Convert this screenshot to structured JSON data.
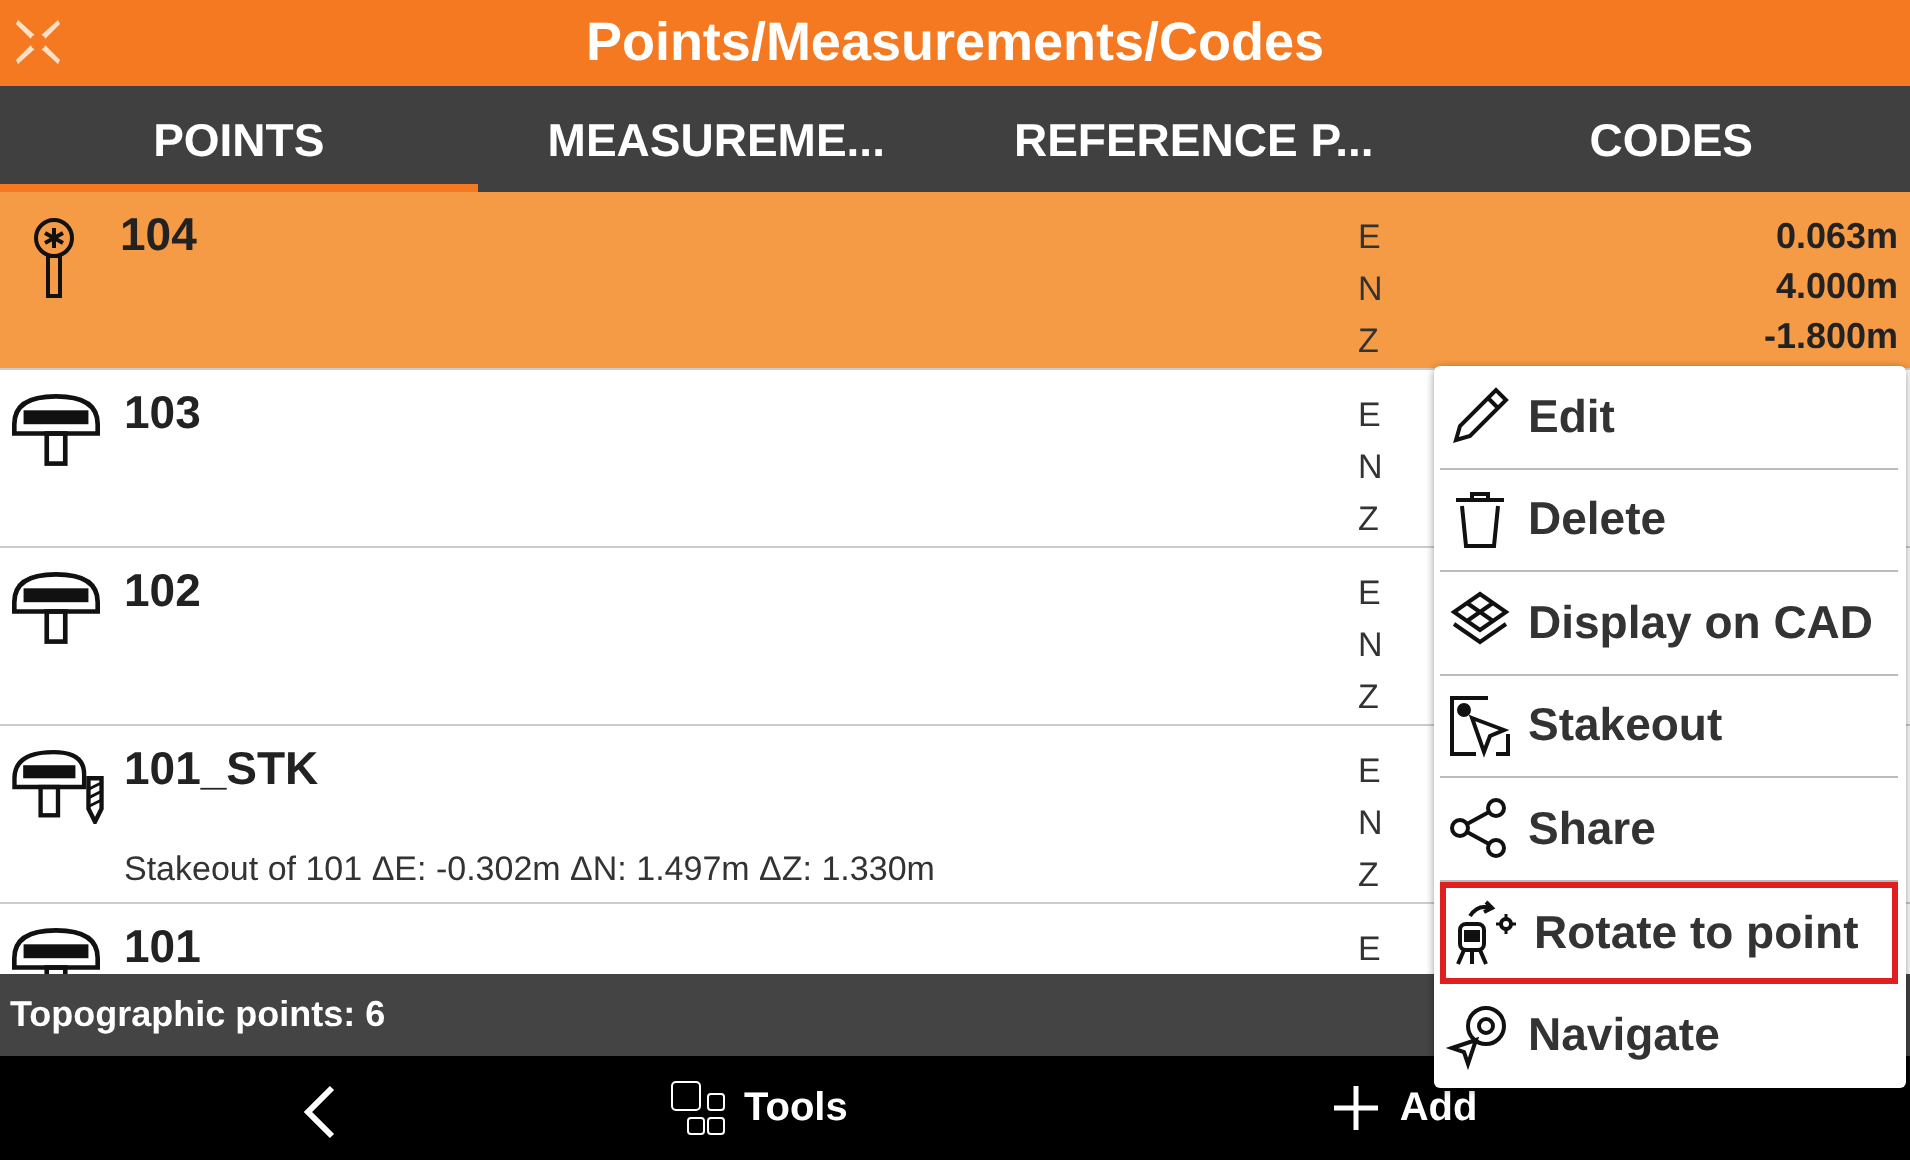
{
  "window": {
    "title": "Points/Measurements/Codes"
  },
  "tabs": [
    {
      "label": "POINTS",
      "selected": true
    },
    {
      "label": "MEASUREME...",
      "selected": false
    },
    {
      "label": "REFERENCE P...",
      "selected": false
    },
    {
      "label": "CODES",
      "selected": false
    }
  ],
  "points": [
    {
      "name": "104",
      "kind": "pole",
      "selected": true,
      "axes": [
        "E",
        "N",
        "Z"
      ],
      "values": [
        "0.063m",
        "4.000m",
        "-1.800m"
      ]
    },
    {
      "name": "103",
      "kind": "receiver",
      "selected": false,
      "axes": [
        "E",
        "N",
        "Z"
      ]
    },
    {
      "name": "102",
      "kind": "receiver",
      "selected": false,
      "axes": [
        "E",
        "N",
        "Z"
      ]
    },
    {
      "name": "101_STK",
      "kind": "stakeout",
      "selected": false,
      "axes": [
        "E",
        "N",
        "Z"
      ],
      "note": "Stakeout of 101 ΔE: -0.302m ΔN: 1.497m ΔZ: 1.330m"
    },
    {
      "name": "101",
      "kind": "receiver",
      "selected": false,
      "axes": [
        "E"
      ]
    }
  ],
  "status_bar": "Topographic points: 6",
  "bottom_bar": [
    {
      "kind": "back"
    },
    {
      "kind": "tools",
      "label": "Tools"
    },
    {
      "kind": "add",
      "label": "Add"
    }
  ],
  "menu": [
    {
      "kind": "edit",
      "label": "Edit",
      "highlighted": false
    },
    {
      "kind": "delete",
      "label": "Delete",
      "highlighted": false
    },
    {
      "kind": "layers",
      "label": "Display on CAD",
      "highlighted": false
    },
    {
      "kind": "stakeout",
      "label": "Stakeout",
      "highlighted": false
    },
    {
      "kind": "share",
      "label": "Share",
      "highlighted": false
    },
    {
      "kind": "rotate",
      "label": "Rotate to point",
      "highlighted": true
    },
    {
      "kind": "navigate",
      "label": "Navigate",
      "highlighted": false
    }
  ]
}
